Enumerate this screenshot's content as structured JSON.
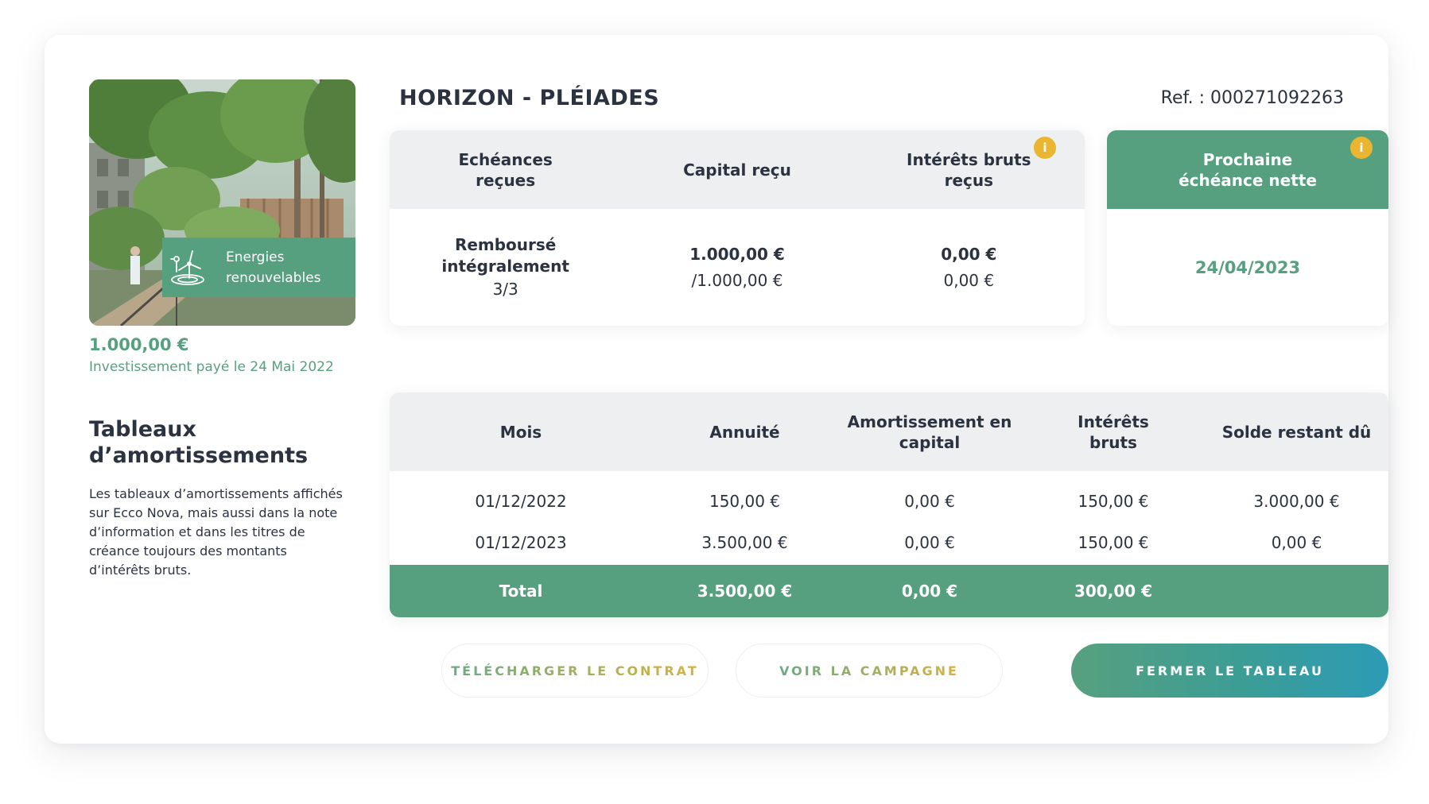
{
  "project": {
    "title": "HORIZON - PLÉIADES",
    "ref": "Ref. : 000271092263"
  },
  "investment": {
    "category": "Energies renouvelables",
    "category_icon": "wind-turbine-icon",
    "amount": "1.000,00 €",
    "paid_date": "Investissement payé le 24 Mai 2022"
  },
  "section": {
    "title": "Tableaux d’amortissements",
    "description": "Les tableaux d’amortissements affichés sur Ecco Nova, mais aussi dans la note d’information et dans les titres de créance toujours des montants d’intérêts bruts."
  },
  "summary": {
    "headers": [
      "Echéances reçues",
      "Capital reçu",
      "Intérêts bruts reçus"
    ],
    "values": [
      {
        "main": "Remboursé intégralement",
        "sub": "3/3"
      },
      {
        "main": "1.000,00 €",
        "sub": "/1.000,00 €"
      },
      {
        "main": "0,00 €",
        "sub": "0,00 €"
      }
    ],
    "info_icon": "i"
  },
  "next_due": {
    "header": "Prochaine échéance nette",
    "value": "24/04/2023",
    "info_icon": "i"
  },
  "amortization": {
    "headers": [
      "Mois",
      "Annuité",
      "Amortissement en capital",
      "Intérêts bruts",
      "Solde restant dû"
    ],
    "rows": [
      [
        "01/12/2022",
        "150,00 €",
        "0,00 €",
        "150,00 €",
        "3.000,00 €"
      ],
      [
        "01/12/2023",
        "3.500,00 €",
        "0,00 €",
        "150,00 €",
        "0,00 €"
      ]
    ],
    "total": [
      "Total",
      "3.500,00 €",
      "0,00 €",
      "300,00 €",
      ""
    ]
  },
  "buttons": {
    "download": "TÉLÉCHARGER LE CONTRAT",
    "campaign": "VOIR LA CAMPAGNE",
    "close": "FERMER LE TABLEAU"
  },
  "colors": {
    "brand_green": "#57a07f",
    "header_gray": "#eeeff1",
    "info_yellow": "#eab632",
    "close_gradient_end": "#2c9bb6"
  }
}
